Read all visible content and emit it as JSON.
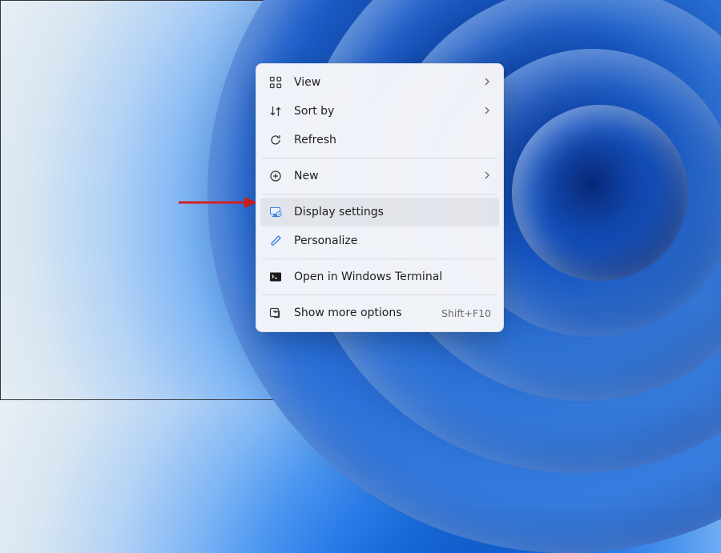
{
  "context_menu": {
    "items": {
      "view": {
        "label": "View"
      },
      "sort_by": {
        "label": "Sort by"
      },
      "refresh": {
        "label": "Refresh"
      },
      "new": {
        "label": "New"
      },
      "display_settings": {
        "label": "Display settings"
      },
      "personalize": {
        "label": "Personalize"
      },
      "open_terminal": {
        "label": "Open in Windows Terminal"
      },
      "show_more_options": {
        "label": "Show more options",
        "shortcut": "Shift+F10"
      }
    }
  },
  "annotation": {
    "arrow_color": "#d81f1f",
    "highlighted_item": "display_settings"
  }
}
